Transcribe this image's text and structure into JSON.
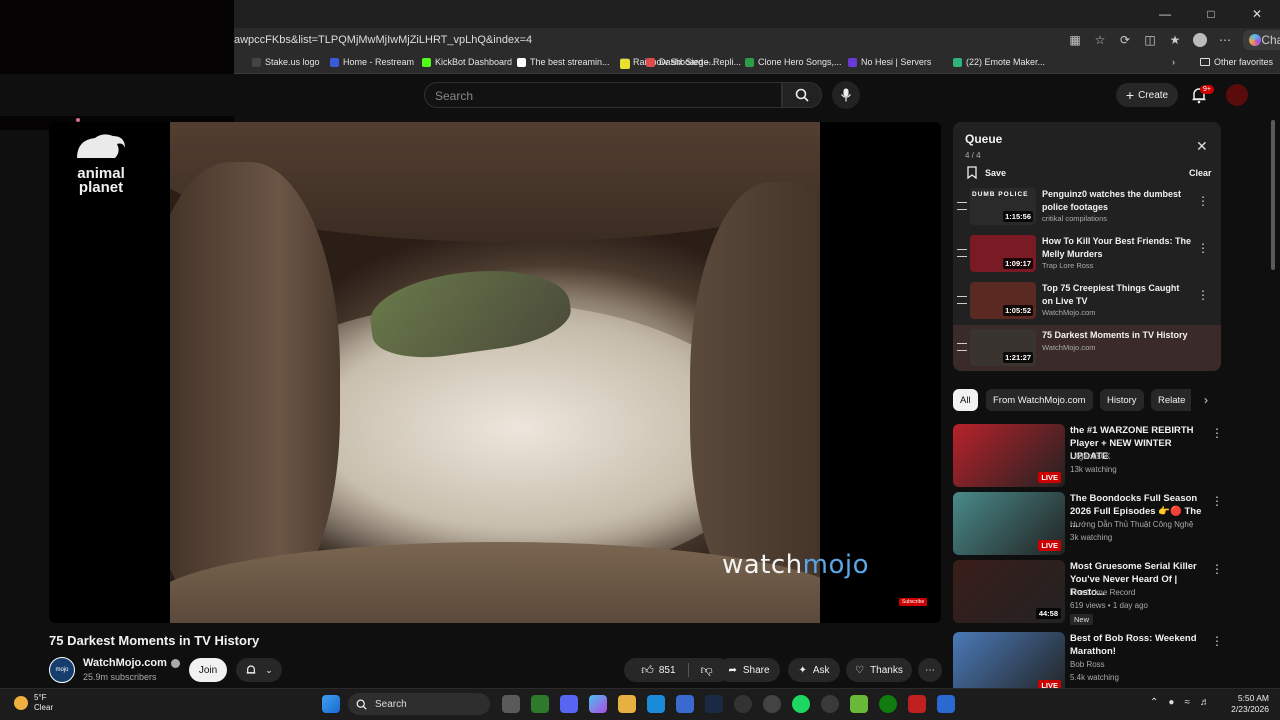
{
  "browser": {
    "url": "awpccFKbs&list=TLPQMjMwMjIwMjZiLHRT_vpLhQ&index=4",
    "chat_label": "Chat",
    "bookmarks": [
      {
        "label": "Stake.us logo",
        "color": "#444"
      },
      {
        "label": "Home - Restream",
        "color": "#3a5bd9"
      },
      {
        "label": "KickBot Dashboard",
        "color": "#53fc18"
      },
      {
        "label": "The best streamin...",
        "color": "#ffffff"
      },
      {
        "label": "Rainbow Six Siege...",
        "color": "#666"
      },
      {
        "label": "Dashboard – Repli...",
        "color": "#e04a4a"
      },
      {
        "label": "Clone Hero Songs,...",
        "color": "#2e9d4a"
      },
      {
        "label": "No Hesi | Servers",
        "color": "#6a3ad6"
      },
      {
        "label": "(22) Emote Maker...",
        "color": "#2fb37a"
      }
    ],
    "other_favorites": "Other favorites"
  },
  "yt": {
    "search_placeholder": "Search",
    "create_label": "Create",
    "notif_badge": "9+"
  },
  "video": {
    "title": "75 Darkest Moments in TV History",
    "overlay_network_1": "animal",
    "overlay_network_2": "planet",
    "watermark_a": "watch",
    "watermark_b": "mojo",
    "subscribe_tag": "Subscribe"
  },
  "channel": {
    "name": "WatchMojo.com",
    "avatar_text": "mojo",
    "subscribers": "25.9m subscribers",
    "join_label": "Join"
  },
  "actions": {
    "likes": "851",
    "share": "Share",
    "ask": "Ask",
    "thanks": "Thanks"
  },
  "queue": {
    "title": "Queue",
    "count": "4 / 4",
    "save": "Save",
    "clear": "Clear",
    "items": [
      {
        "title": "Penguinz0 watches the dumbest police footages",
        "channel": "critikal compilations",
        "duration": "1:15:56",
        "thumb": "#2a2a2a",
        "thumb_text": "DUMB POLICE"
      },
      {
        "title": "How To Kill Your Best Friends: The Melly Murders",
        "channel": "Trap Lore Ross",
        "duration": "1:09:17",
        "thumb": "#7a1a24",
        "thumb_text": ""
      },
      {
        "title": "Top 75 Creepiest Things Caught on Live TV",
        "channel": "WatchMojo.com",
        "duration": "1:05:52",
        "thumb": "#5a2a22",
        "thumb_text": ""
      },
      {
        "title": "75 Darkest Moments in TV History",
        "channel": "WatchMojo.com",
        "duration": "1:21:27",
        "thumb": "#3a3430",
        "thumb_text": ""
      }
    ]
  },
  "chips": [
    "All",
    "From WatchMojo.com",
    "History",
    "Relate"
  ],
  "recs": [
    {
      "title": "the  #1 WARZONE REBIRTH Player + NEW WINTER UPDATE",
      "channel": "Legends6K",
      "meta": "13k watching",
      "badge": "LIVE",
      "thumb": "#b8222a",
      "new": ""
    },
    {
      "title": "The Boondocks Full Season 2026 Full Episodes 👉🔴 The ...",
      "channel": "Hướng Dẫn Thủ Thuật Công Nghệ",
      "meta": "3k watching",
      "badge": "LIVE",
      "thumb": "#4a8a8a",
      "new": ""
    },
    {
      "title": "Most Gruesome Serial Killer You've Never Heard Of | Rosto...",
      "channel": "The Crime Record",
      "meta": "619 views • 1 day ago",
      "badge": "44:58",
      "thumb": "#3a1e1a",
      "new": "New"
    },
    {
      "title": "Best of Bob Ross: Weekend Marathon!",
      "channel": "Bob Ross",
      "meta": "5.4k watching",
      "badge": "LIVE",
      "thumb": "#4a7ab8",
      "new": ""
    }
  ],
  "taskbar": {
    "temp": "5°F",
    "weather": "Clear",
    "search": "Search",
    "time": "5:50 AM",
    "date": "2/23/2026"
  }
}
